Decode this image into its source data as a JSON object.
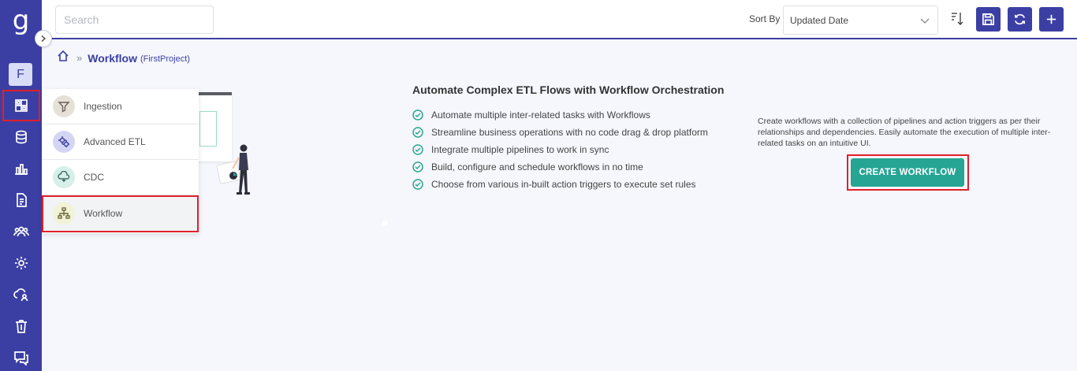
{
  "app": {
    "logo_text": "g",
    "project_badge": "F"
  },
  "colors": {
    "brand": "#3b3fa4",
    "accent": "#26a594",
    "highlight": "#e0202a"
  },
  "nav": {
    "items": [
      {
        "name": "dashboard-icon",
        "active": true
      },
      {
        "name": "database-icon"
      },
      {
        "name": "chart-icon"
      },
      {
        "name": "document-icon"
      },
      {
        "name": "users-icon"
      },
      {
        "name": "settings-icon"
      },
      {
        "name": "cloud-user-icon"
      },
      {
        "name": "trash-icon"
      },
      {
        "name": "chat-icon"
      }
    ]
  },
  "topbar": {
    "search_placeholder": "Search",
    "sort_label": "Sort By",
    "sort_value": "Updated Date",
    "buttons": [
      "save-icon",
      "refresh-icon",
      "plus-icon"
    ]
  },
  "breadcrumb": {
    "title": "Workflow",
    "project": "(FirstProject)"
  },
  "menu": {
    "items": [
      {
        "label": "Ingestion",
        "icon": "funnel-icon"
      },
      {
        "label": "Advanced ETL",
        "icon": "gears-icon"
      },
      {
        "label": "CDC",
        "icon": "cloud-sync-icon"
      },
      {
        "label": "Workflow",
        "icon": "workflow-icon",
        "selected": true
      }
    ]
  },
  "content": {
    "heading": "Automate Complex ETL Flows with Workflow Orchestration",
    "features": [
      "Automate multiple inter-related tasks with Workflows",
      "Streamline business operations with no code drag & drop platform",
      "Integrate multiple pipelines to work in sync",
      "Build, configure and schedule workflows in no time",
      "Choose from various in-built action triggers to execute set rules"
    ],
    "description": "Create workflows with a collection of pipelines and action triggers as per their relationships and dependencies. Easily automate the execution of multiple inter-related tasks on an intuitive UI.",
    "cta_label": "CREATE WORKFLOW"
  }
}
